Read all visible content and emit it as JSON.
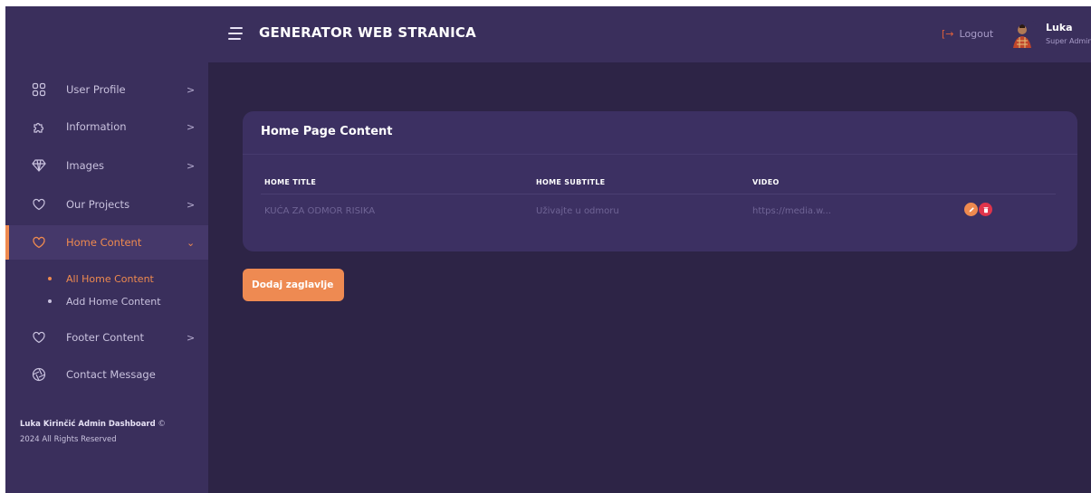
{
  "header": {
    "title": "GENERATOR WEB STRANICA",
    "logout_label": "Logout",
    "user_name": "Luka",
    "user_role": "Super Admin"
  },
  "sidebar": {
    "items": [
      {
        "label": "User Profile",
        "icon": "grid-icon",
        "chevron": ">"
      },
      {
        "label": "Information",
        "icon": "puzzle-icon",
        "chevron": ">"
      },
      {
        "label": "Images",
        "icon": "diamond-icon",
        "chevron": ">"
      },
      {
        "label": "Our Projects",
        "icon": "heart-icon",
        "chevron": ">"
      },
      {
        "label": "Home Content",
        "icon": "heart-icon",
        "chevron": "⌄"
      },
      {
        "label": "Footer Content",
        "icon": "heart-icon",
        "chevron": ">"
      },
      {
        "label": "Contact Message",
        "icon": "aperture-icon"
      }
    ],
    "subitems": [
      {
        "label": "All Home Content"
      },
      {
        "label": "Add Home Content"
      }
    ],
    "copyright_bold": "Luka Kirinčić Admin Dashboard",
    "copyright_symbol": "©",
    "copyright_rest": "2024 All Rights Reserved"
  },
  "card": {
    "title": "Home Page Content",
    "columns": [
      "HOME TITLE",
      "HOME SUBTITLE",
      "VIDEO"
    ],
    "rows": [
      {
        "title": "KUĆA ZA ODMOR RISIKA",
        "subtitle": "Uživajte u odmoru",
        "video": "https://media.w..."
      }
    ]
  },
  "add_button_label": "Dodaj zaglavlje",
  "colors": {
    "accent": "#ef8a4f",
    "danger": "#e0344b",
    "sidebar_bg": "#3a2f5c",
    "main_bg": "#2d2446"
  }
}
